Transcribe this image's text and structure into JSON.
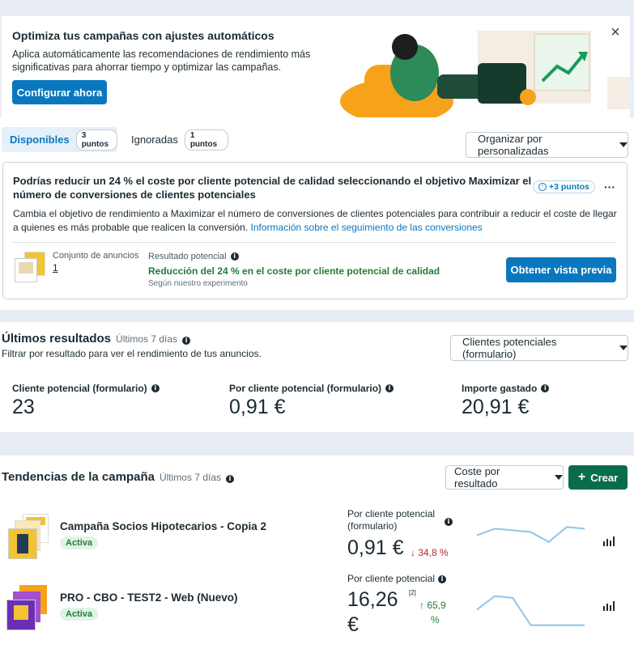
{
  "banner": {
    "title": "Optimiza tus campañas con ajustes automáticos",
    "desc_line1": "Aplica automáticamente las recomendaciones de rendimiento más",
    "desc_line2": "significativas para ahorrar tiempo y optimizar las campañas.",
    "cta": "Configurar ahora",
    "close": "×"
  },
  "tabs": {
    "available_label": "Disponibles",
    "available_badge": "3 puntos",
    "ignored_label": "Ignoradas",
    "ignored_badge": "1 puntos",
    "sort_label": "Organizar por personalizadas"
  },
  "recommendation": {
    "title_line1": "Podrías reducir un 24 % el coste por cliente potencial de calidad seleccionando el objetivo Maximizar el",
    "title_line2": "número de conversiones de clientes potenciales",
    "points": "+3 puntos",
    "more": "···",
    "body_line1": "Cambia el objetivo de rendimiento a Maximizar el número de conversiones de clientes potenciales para contribuir a reducir el coste de llegar",
    "body_line2_prefix": "a quienes es más probable que realicen la conversión. ",
    "body_link": "Información sobre el seguimiento de las conversiones",
    "adset_label": "Conjunto de anuncios",
    "adset_value": "1",
    "result_label": "Resultado potencial",
    "result_value": "Reducción del 24 % en el coste por cliente potencial de calidad",
    "result_note": "Según nuestro experimento",
    "preview_button": "Obtener vista previa"
  },
  "results": {
    "title": "Últimos resultados",
    "period": "Últimos 7 días",
    "subtitle": "Filtrar por resultado para ver el rendimiento de tus anuncios.",
    "filter_label": "Clientes potenciales (formulario)",
    "metrics": [
      {
        "label": "Cliente potencial (formulario)",
        "value": "23"
      },
      {
        "label": "Por cliente potencial (formulario)",
        "value": "0,91 €"
      },
      {
        "label": "Importe gastado",
        "value": "20,91 €"
      }
    ]
  },
  "trends": {
    "title": "Tendencias de la campaña",
    "period": "Últimos 7 días",
    "metric_select": "Coste por resultado",
    "create_button": "Crear",
    "create_icon": "plus-icon",
    "campaigns": [
      {
        "name": "Campaña Socios Hipotecarios - Copia 2",
        "status": "Activa",
        "metric_label_line1": "Por cliente potencial",
        "metric_label_line2": "(formulario)",
        "value": "0,91 €",
        "change": "↓ 34,8 %",
        "change_color": "#b3261e",
        "sparkline": [
          0.55,
          0.35,
          0.4,
          0.45,
          0.75,
          0.3,
          0.35
        ]
      },
      {
        "name": "PRO - CBO - TEST2 - Web (Nuevo)",
        "status": "Activa",
        "metric_label_line1": "Por cliente potencial",
        "value_line1": "16,26",
        "value_line2": "€",
        "footnote": "[2]",
        "change_line1": "↑ 65,9",
        "change_line2": "%",
        "change_color": "#237b3a",
        "sparkline": [
          0.55,
          0.2,
          0.25,
          0.95,
          0.95,
          0.95,
          0.95
        ]
      }
    ]
  },
  "colors": {
    "accent": "#0a78be",
    "create": "#0a6d4a",
    "result_green": "#237b3a"
  }
}
